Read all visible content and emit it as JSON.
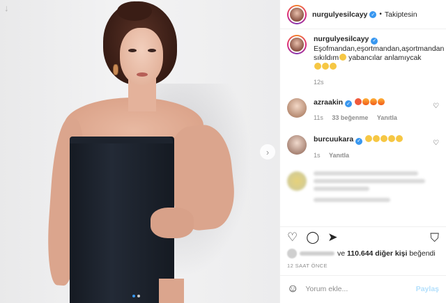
{
  "photo": {
    "top_arrow_icon": "arrow-down-icon",
    "next_icon": "chevron-right-icon",
    "dots": 2,
    "active_dot": 1
  },
  "header": {
    "username": "nurgulyesilcayy",
    "separator": "•",
    "follow_status": "Takiptesin"
  },
  "caption": {
    "username": "nurgulyesilcayy",
    "text": "Eşofmandan,eşortmandan,aşortmandan sıkıldım",
    "text_after": "yabancılar anlamıycak",
    "time": "12s"
  },
  "comments": [
    {
      "username": "azraakin",
      "time": "11s",
      "likes": "33 beğenme",
      "reply": "Yanıtla"
    },
    {
      "username": "burcuukara",
      "time": "1s",
      "likes": "",
      "reply": "Yanıtla"
    }
  ],
  "likes": {
    "connector": "ve",
    "count": "110.644 diğer kişi",
    "suffix": "beğendi"
  },
  "posted_time": "12 SAAT ÖNCE",
  "composer": {
    "placeholder": "Yorum ekle...",
    "post_label": "Paylaş"
  },
  "colors": {
    "link_blue": "#3897f0",
    "post_disabled": "#b2dffc",
    "muted": "#8e8e8e",
    "text": "#262626"
  }
}
